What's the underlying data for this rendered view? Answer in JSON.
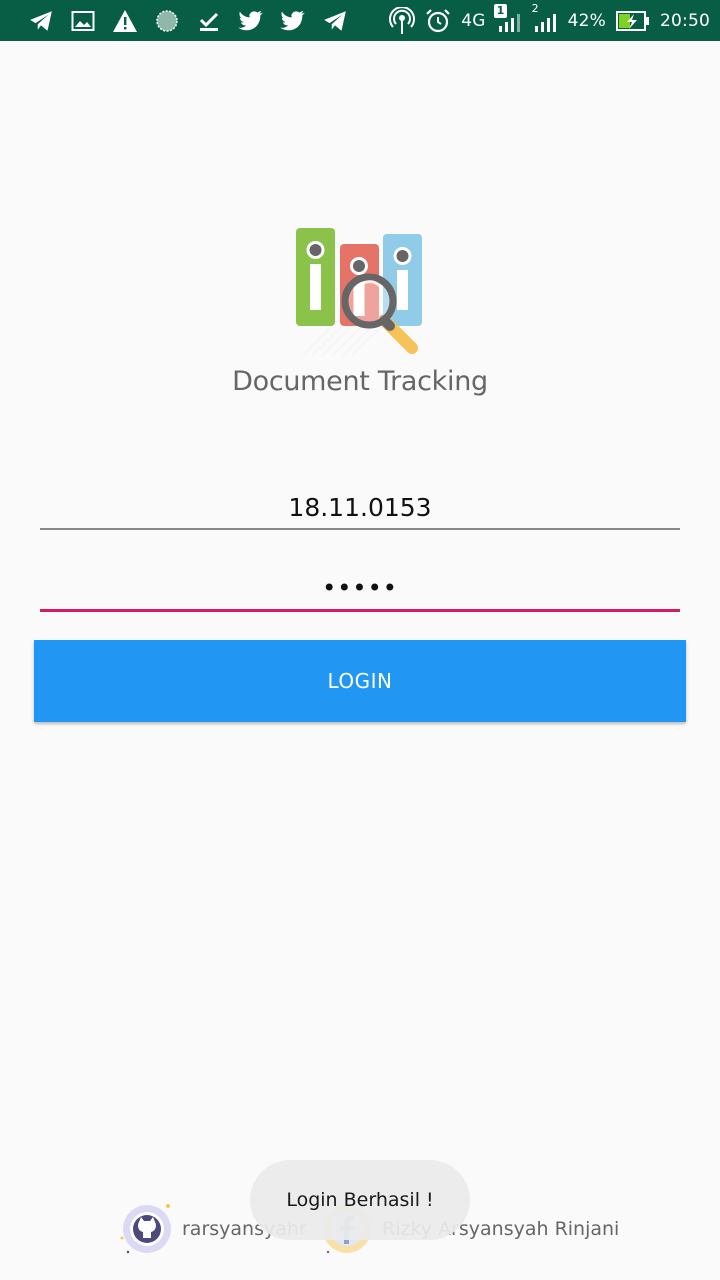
{
  "status_bar": {
    "left_icons": [
      "telegram-icon",
      "gallery-icon",
      "warning-icon",
      "sync-icon",
      "download-done-icon",
      "twitter-icon",
      "twitter-icon",
      "telegram-icon"
    ],
    "network_label": "4G",
    "sim1_badge": "1",
    "sim2_badge": "2",
    "battery_percent": "42%",
    "time": "20:50",
    "bar_color": "#075e45"
  },
  "app": {
    "title": "Document Tracking",
    "logo_icon": "document-search-logo"
  },
  "login_form": {
    "username_value": "18.11.0153",
    "password_value": "•••••",
    "login_label": "LOGIN",
    "accent_color": "#d81b60",
    "button_color": "#2196f3"
  },
  "footer": {
    "github_label": "rarsyansyahr",
    "github_icon": "github-icon",
    "facebook_label": "Rizky Arsyansyah Rinjani",
    "facebook_icon": "facebook-icon"
  },
  "toast": {
    "message": "Login Berhasil !"
  }
}
